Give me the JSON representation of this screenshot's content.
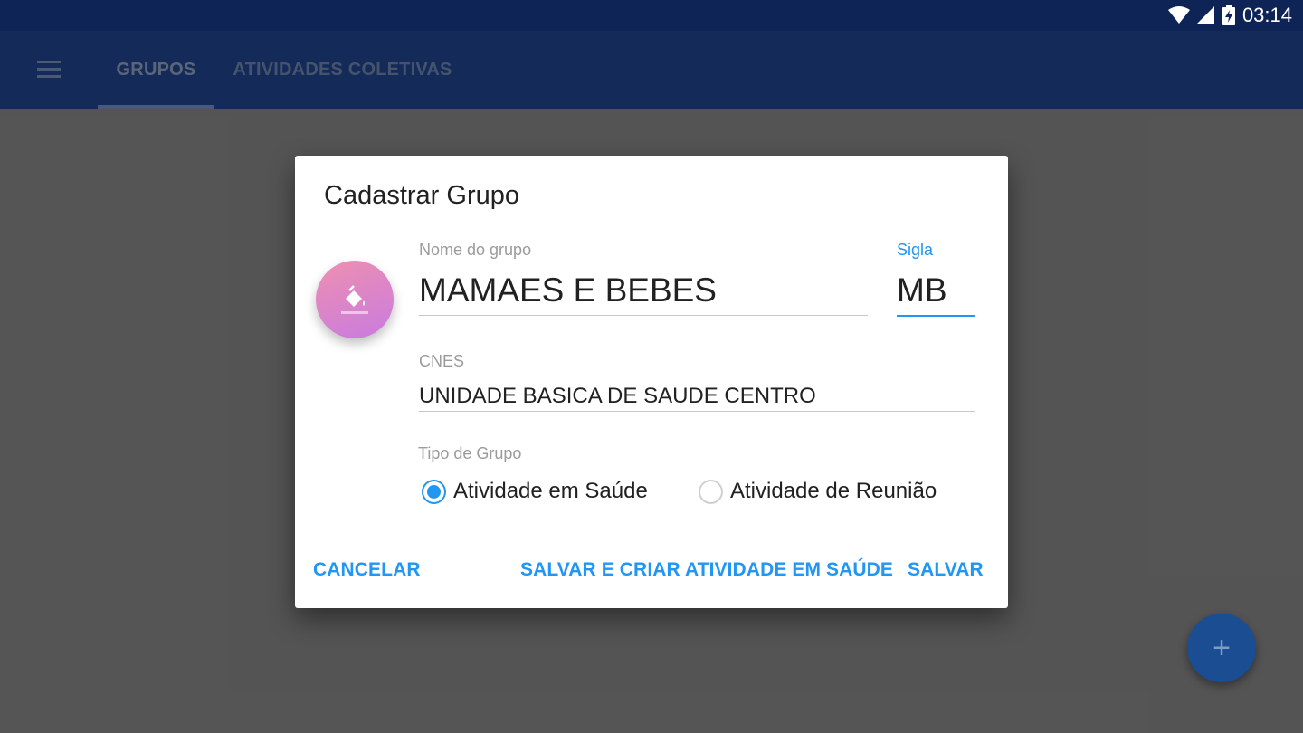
{
  "status_bar": {
    "time": "03:14",
    "icons": [
      "wifi-icon",
      "signal-icon",
      "battery-charging-icon"
    ]
  },
  "app_bar": {
    "menu_icon": "hamburger-menu-icon",
    "tabs": [
      {
        "label": "GRUPOS",
        "selected": true
      },
      {
        "label": "ATIVIDADES COLETIVAS",
        "selected": false
      }
    ]
  },
  "fab": {
    "icon": "plus-icon",
    "label": "+"
  },
  "dialog": {
    "title": "Cadastrar Grupo",
    "color_button": {
      "icon": "paint-bucket-icon",
      "gradient": [
        "#ee8fb0",
        "#c97be0"
      ]
    },
    "nome": {
      "label": "Nome do grupo",
      "value": "MAMAES E BEBES"
    },
    "sigla": {
      "label": "Sigla",
      "value": "MB"
    },
    "cnes": {
      "label": "CNES",
      "value": "UNIDADE BASICA DE SAUDE CENTRO"
    },
    "tipo": {
      "label": "Tipo de Grupo",
      "options": [
        {
          "label": "Atividade em Saúde",
          "checked": true
        },
        {
          "label": "Atividade de Reunião",
          "checked": false
        }
      ]
    },
    "actions": {
      "cancel": "CANCELAR",
      "save_and_create": "SALVAR E CRIAR ATIVIDADE EM SAÚDE",
      "save": "SALVAR"
    }
  },
  "colors": {
    "accent": "#2196f3",
    "app_bar": "#254ea0",
    "status_bar": "#0f2456"
  }
}
